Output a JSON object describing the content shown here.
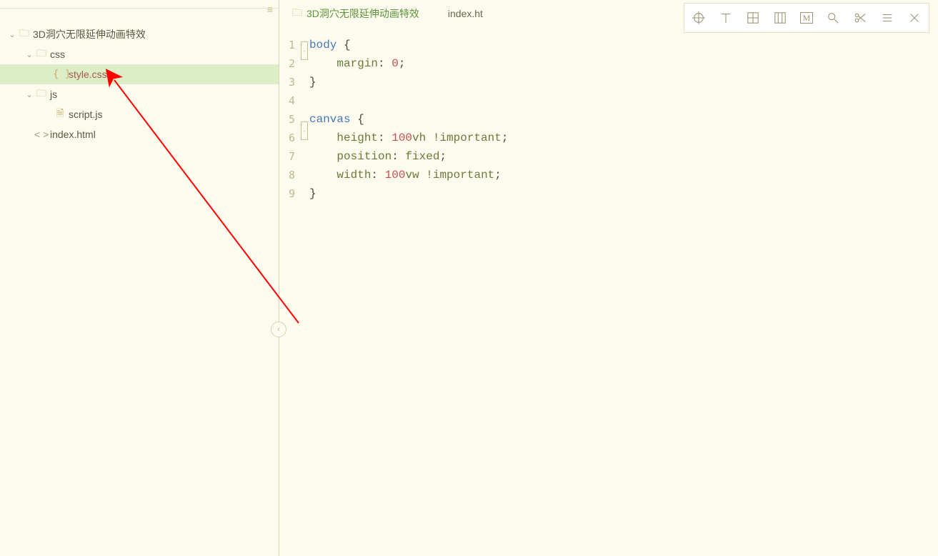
{
  "sidebar": {
    "root": {
      "label": "3D洞穴无限延伸动画特效"
    },
    "css_folder": {
      "label": "css"
    },
    "style_file": {
      "label": "style.css"
    },
    "js_folder": {
      "label": "js"
    },
    "script_file": {
      "label": "script.js"
    },
    "index_file": {
      "label": "index.html"
    }
  },
  "tabs": {
    "breadcrumb": {
      "label": "3D洞穴无限延伸动画特效"
    },
    "open": {
      "label": "index.ht"
    }
  },
  "toolbar": {
    "target": "crosshair-icon",
    "t": "t-icon",
    "grid": "grid-icon",
    "columns": "columns-icon",
    "m": "M",
    "search": "search-icon",
    "scissors": "scissors-icon",
    "menu": "menu-icon",
    "close": "close-icon"
  },
  "code": {
    "lines": [
      "1",
      "2",
      "3",
      "4",
      "5",
      "6",
      "7",
      "8",
      "9"
    ],
    "l1_sel": "body",
    "l1_brace": " {",
    "l2_prop": "margin",
    "l2_colon": ": ",
    "l2_num": "0",
    "l2_semi": ";",
    "l3_brace": "}",
    "l5_sel": "canvas",
    "l5_brace": " {",
    "l6_prop": "height",
    "l6_colon": ": ",
    "l6_num": "100",
    "l6_unit": "vh",
    "l6_sp": " ",
    "l6_imp": "!important",
    "l6_semi": ";",
    "l7_prop": "position",
    "l7_colon": ": ",
    "l7_val": "fixed",
    "l7_semi": ";",
    "l8_prop": "width",
    "l8_colon": ": ",
    "l8_num": "100",
    "l8_unit": "vw",
    "l8_sp": " ",
    "l8_imp": "!important",
    "l8_semi": ";",
    "l9_brace": "}"
  }
}
